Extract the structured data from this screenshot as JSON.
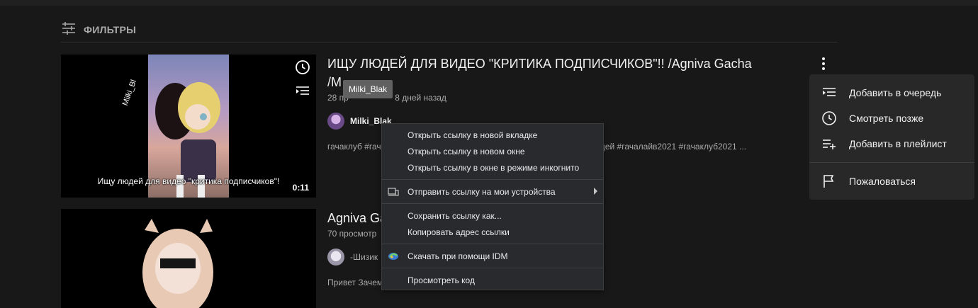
{
  "filters": {
    "label": "ФИЛЬТРЫ",
    "icon": "filter-sliders-icon"
  },
  "videos": [
    {
      "title_line1": "ИЩУ ЛЮДЕЙ ДЛЯ ВИДЕО \"КРИТИКА ПОДПИСЧИКОВ\"!! /Agniva Gacha",
      "title_line2": "/M",
      "views": "28 пр",
      "age": "8 дней назад",
      "channel": "Milki_Blak",
      "description_left": "гачаклуб #гач",
      "description_right": "рное #ищулюдей #гачалайв2021 #гачаклуб2021 ...",
      "thumbnail_caption": "Ищу людей для видео \"критика подписчиков\"!",
      "thumbnail_watermark": "Milki_Bl",
      "duration": "0:11"
    },
    {
      "title": "Agniva Ga",
      "views": "70 просмотр",
      "channel": "-Шизик",
      "description": "Привет Зачем"
    }
  ],
  "tooltip": "Milki_Blak",
  "video_menu": {
    "items": [
      {
        "label": "Добавить в очередь",
        "icon": "add-to-queue-icon"
      },
      {
        "label": "Смотреть позже",
        "icon": "clock-icon"
      },
      {
        "label": "Добавить в плейлист",
        "icon": "playlist-add-icon"
      },
      {
        "label": "Пожаловаться",
        "icon": "flag-icon"
      }
    ]
  },
  "context_menu": {
    "items": [
      {
        "label": "Открыть ссылку в новой вкладке"
      },
      {
        "label": "Открыть ссылку в новом окне"
      },
      {
        "label": "Открыть ссылку в окне в режиме инкогнито"
      },
      {
        "label": "Отправить ссылку на мои устройства",
        "icon": "devices-icon"
      },
      {
        "label": "Сохранить ссылку как..."
      },
      {
        "label": "Копировать адрес ссылки"
      },
      {
        "label": "Скачать при помощи IDM",
        "icon": "idm-icon"
      },
      {
        "label": "Просмотреть код"
      }
    ]
  },
  "colors": {
    "background": "#181818",
    "menu": "#282828",
    "context_menu": "#292a2d",
    "text": "#f1f1f1",
    "secondary_text": "#aaaaaa"
  }
}
